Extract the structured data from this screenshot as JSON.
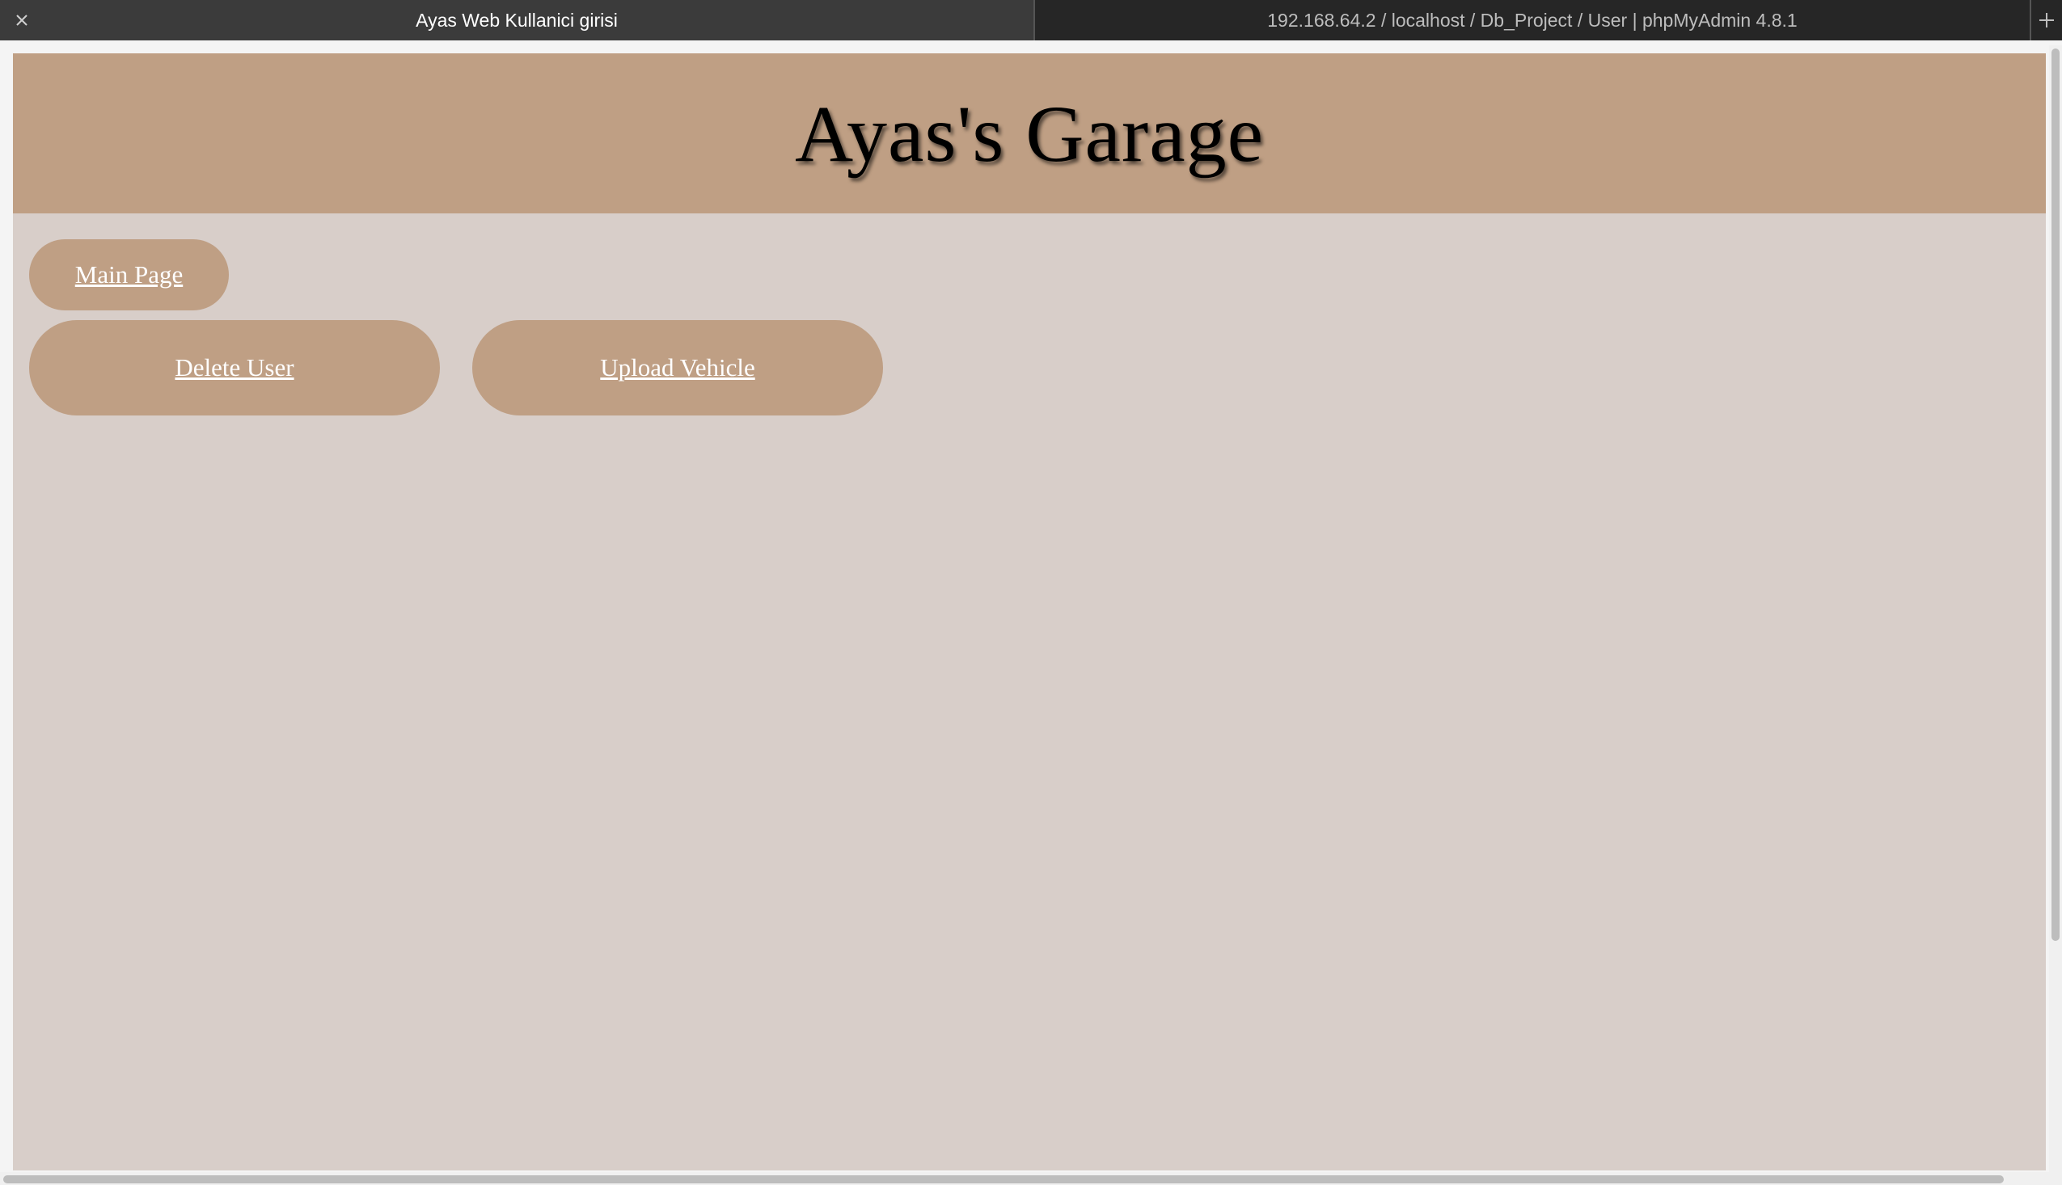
{
  "browser": {
    "tabs": [
      {
        "title": "Ayas Web Kullanici girisi",
        "active": true
      },
      {
        "title": "192.168.64.2 / localhost / Db_Project / User | phpMyAdmin 4.8.1",
        "active": false
      }
    ],
    "close_icon": "close-icon",
    "new_tab_icon": "plus-icon"
  },
  "page": {
    "title": "Ayas's Garage",
    "nav": {
      "main_page": "Main Page",
      "delete_user": "Delete User",
      "upload_vehicle": "Upload Vehicle"
    }
  },
  "colors": {
    "header_bg": "#bf9f84",
    "page_bg": "#d8cec9",
    "button_bg": "#bf9f84",
    "button_text": "#ffffff",
    "tabbar_bg": "#2a2a2a",
    "active_tab_bg": "#3b3b3b"
  }
}
